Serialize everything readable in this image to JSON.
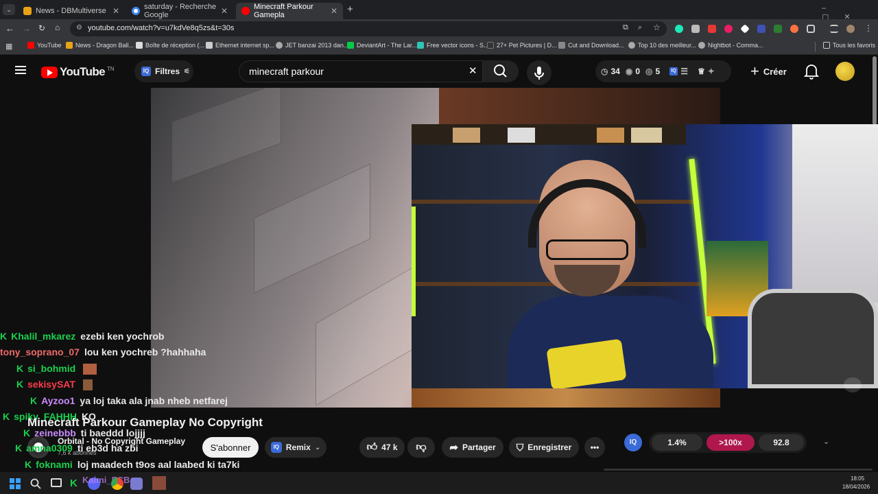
{
  "browser": {
    "tabs": [
      {
        "label": "News - DBMultiverse",
        "active": false,
        "color": "#e8a317"
      },
      {
        "label": "saturday - Recherche Google",
        "active": false,
        "color": "#4285f4"
      },
      {
        "label": "Minecraft Parkour Gamepla",
        "active": true,
        "color": "#ff0000"
      }
    ],
    "url": "youtube.com/watch?v=u7kdVe8q5zs&t=30s",
    "bookmarks": [
      {
        "label": "YouTube",
        "color": "#ff0000"
      },
      {
        "label": "News - Dragon Ball...",
        "color": "#e8a317"
      },
      {
        "label": "Boîte de réception (...",
        "color": "#dddddd"
      },
      {
        "label": "Ethernet internet sp...",
        "color": "#cccccc"
      },
      {
        "label": "JET banzai 2013 dan...",
        "color": "#aaaaaa"
      },
      {
        "label": "DeviantArt - The Lar...",
        "color": "#05cc47"
      },
      {
        "label": "Free vector icons - S...",
        "color": "#2ec4b6"
      },
      {
        "label": "27+ Pet Pictures | D...",
        "color": "#333333"
      },
      {
        "label": "Cut and Download...",
        "color": "#888888"
      },
      {
        "label": "Top 10 des meilleur...",
        "color": "#aaaaaa"
      },
      {
        "label": "Nightbot - Comma...",
        "color": "#aaaaaa"
      }
    ],
    "all_bookmarks": "Tous les favoris"
  },
  "youtube": {
    "logo_text": "YouTube",
    "logo_region": "TN",
    "filters_label": "Filtres",
    "search_value": "minecraft parkour",
    "stats": {
      "a": "34",
      "b": "0",
      "c": "5"
    },
    "create_label": "Créer"
  },
  "chat": [
    {
      "user": "Khalil_mkarez",
      "color": "#19d14f",
      "msg": "ezebi ken yochrob"
    },
    {
      "user": "tony_soprano_07",
      "color": "#f06a6a",
      "msg": "lou ken yochreb ?hahhaha"
    },
    {
      "user": "si_bohmid",
      "color": "#19d14f",
      "msg": ""
    },
    {
      "user": "sekisySAT",
      "color": "#ff3b4a",
      "msg": ""
    },
    {
      "user": "Ayzoo1",
      "color": "#c98bff",
      "msg": "ya loj taka ala jnab nheb netfarej"
    },
    {
      "user": "spiky_FAHHH",
      "color": "#19d14f",
      "msg": "KO"
    },
    {
      "user": "zeinebbb",
      "color": "#c98bff",
      "msg": "ti baeddd lojjjj"
    },
    {
      "user": "amna0309",
      "color": "#19d14f",
      "msg": "ti eb3d ha zbi"
    },
    {
      "user": "foknami",
      "color": "#19d14f",
      "msg": "loj maadech t9os aal laabed ki ta7ki"
    },
    {
      "user": "Kaimi_FCB",
      "color": "#c98bff",
      "msg": ""
    }
  ],
  "video": {
    "title": "Minecraft Parkour Gameplay No Copyright",
    "channel": "Orbital - No Copyright Gameplay",
    "subscribers": "7,6 k abonnés",
    "subscribe_label": "S'abonner",
    "remix_label": "Remix",
    "likes": "47 k",
    "share_label": "Partager",
    "save_label": "Enregistrer"
  },
  "iq_stats": {
    "pct": "1.4%",
    "mult": ">100x",
    "score": "92.8"
  },
  "taskbar": {
    "time": "18:05",
    "date": "18/04/2026"
  }
}
